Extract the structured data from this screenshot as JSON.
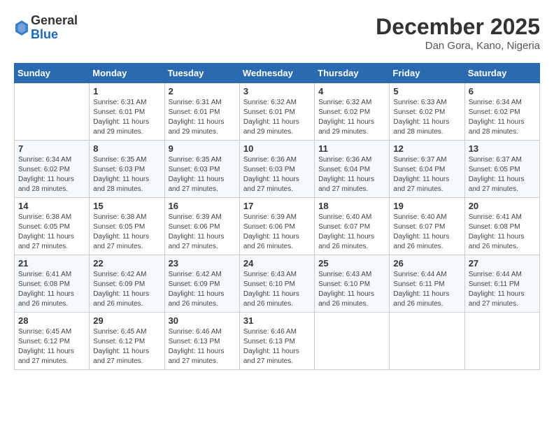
{
  "header": {
    "logo_general": "General",
    "logo_blue": "Blue",
    "month": "December 2025",
    "location": "Dan Gora, Kano, Nigeria"
  },
  "days_of_week": [
    "Sunday",
    "Monday",
    "Tuesday",
    "Wednesday",
    "Thursday",
    "Friday",
    "Saturday"
  ],
  "weeks": [
    [
      {
        "day": "",
        "info": ""
      },
      {
        "day": "1",
        "info": "Sunrise: 6:31 AM\nSunset: 6:01 PM\nDaylight: 11 hours\nand 29 minutes."
      },
      {
        "day": "2",
        "info": "Sunrise: 6:31 AM\nSunset: 6:01 PM\nDaylight: 11 hours\nand 29 minutes."
      },
      {
        "day": "3",
        "info": "Sunrise: 6:32 AM\nSunset: 6:01 PM\nDaylight: 11 hours\nand 29 minutes."
      },
      {
        "day": "4",
        "info": "Sunrise: 6:32 AM\nSunset: 6:02 PM\nDaylight: 11 hours\nand 29 minutes."
      },
      {
        "day": "5",
        "info": "Sunrise: 6:33 AM\nSunset: 6:02 PM\nDaylight: 11 hours\nand 28 minutes."
      },
      {
        "day": "6",
        "info": "Sunrise: 6:34 AM\nSunset: 6:02 PM\nDaylight: 11 hours\nand 28 minutes."
      }
    ],
    [
      {
        "day": "7",
        "info": "Sunrise: 6:34 AM\nSunset: 6:02 PM\nDaylight: 11 hours\nand 28 minutes."
      },
      {
        "day": "8",
        "info": "Sunrise: 6:35 AM\nSunset: 6:03 PM\nDaylight: 11 hours\nand 28 minutes."
      },
      {
        "day": "9",
        "info": "Sunrise: 6:35 AM\nSunset: 6:03 PM\nDaylight: 11 hours\nand 27 minutes."
      },
      {
        "day": "10",
        "info": "Sunrise: 6:36 AM\nSunset: 6:03 PM\nDaylight: 11 hours\nand 27 minutes."
      },
      {
        "day": "11",
        "info": "Sunrise: 6:36 AM\nSunset: 6:04 PM\nDaylight: 11 hours\nand 27 minutes."
      },
      {
        "day": "12",
        "info": "Sunrise: 6:37 AM\nSunset: 6:04 PM\nDaylight: 11 hours\nand 27 minutes."
      },
      {
        "day": "13",
        "info": "Sunrise: 6:37 AM\nSunset: 6:05 PM\nDaylight: 11 hours\nand 27 minutes."
      }
    ],
    [
      {
        "day": "14",
        "info": "Sunrise: 6:38 AM\nSunset: 6:05 PM\nDaylight: 11 hours\nand 27 minutes."
      },
      {
        "day": "15",
        "info": "Sunrise: 6:38 AM\nSunset: 6:05 PM\nDaylight: 11 hours\nand 27 minutes."
      },
      {
        "day": "16",
        "info": "Sunrise: 6:39 AM\nSunset: 6:06 PM\nDaylight: 11 hours\nand 27 minutes."
      },
      {
        "day": "17",
        "info": "Sunrise: 6:39 AM\nSunset: 6:06 PM\nDaylight: 11 hours\nand 26 minutes."
      },
      {
        "day": "18",
        "info": "Sunrise: 6:40 AM\nSunset: 6:07 PM\nDaylight: 11 hours\nand 26 minutes."
      },
      {
        "day": "19",
        "info": "Sunrise: 6:40 AM\nSunset: 6:07 PM\nDaylight: 11 hours\nand 26 minutes."
      },
      {
        "day": "20",
        "info": "Sunrise: 6:41 AM\nSunset: 6:08 PM\nDaylight: 11 hours\nand 26 minutes."
      }
    ],
    [
      {
        "day": "21",
        "info": "Sunrise: 6:41 AM\nSunset: 6:08 PM\nDaylight: 11 hours\nand 26 minutes."
      },
      {
        "day": "22",
        "info": "Sunrise: 6:42 AM\nSunset: 6:09 PM\nDaylight: 11 hours\nand 26 minutes."
      },
      {
        "day": "23",
        "info": "Sunrise: 6:42 AM\nSunset: 6:09 PM\nDaylight: 11 hours\nand 26 minutes."
      },
      {
        "day": "24",
        "info": "Sunrise: 6:43 AM\nSunset: 6:10 PM\nDaylight: 11 hours\nand 26 minutes."
      },
      {
        "day": "25",
        "info": "Sunrise: 6:43 AM\nSunset: 6:10 PM\nDaylight: 11 hours\nand 26 minutes."
      },
      {
        "day": "26",
        "info": "Sunrise: 6:44 AM\nSunset: 6:11 PM\nDaylight: 11 hours\nand 26 minutes."
      },
      {
        "day": "27",
        "info": "Sunrise: 6:44 AM\nSunset: 6:11 PM\nDaylight: 11 hours\nand 27 minutes."
      }
    ],
    [
      {
        "day": "28",
        "info": "Sunrise: 6:45 AM\nSunset: 6:12 PM\nDaylight: 11 hours\nand 27 minutes."
      },
      {
        "day": "29",
        "info": "Sunrise: 6:45 AM\nSunset: 6:12 PM\nDaylight: 11 hours\nand 27 minutes."
      },
      {
        "day": "30",
        "info": "Sunrise: 6:46 AM\nSunset: 6:13 PM\nDaylight: 11 hours\nand 27 minutes."
      },
      {
        "day": "31",
        "info": "Sunrise: 6:46 AM\nSunset: 6:13 PM\nDaylight: 11 hours\nand 27 minutes."
      },
      {
        "day": "",
        "info": ""
      },
      {
        "day": "",
        "info": ""
      },
      {
        "day": "",
        "info": ""
      }
    ]
  ]
}
